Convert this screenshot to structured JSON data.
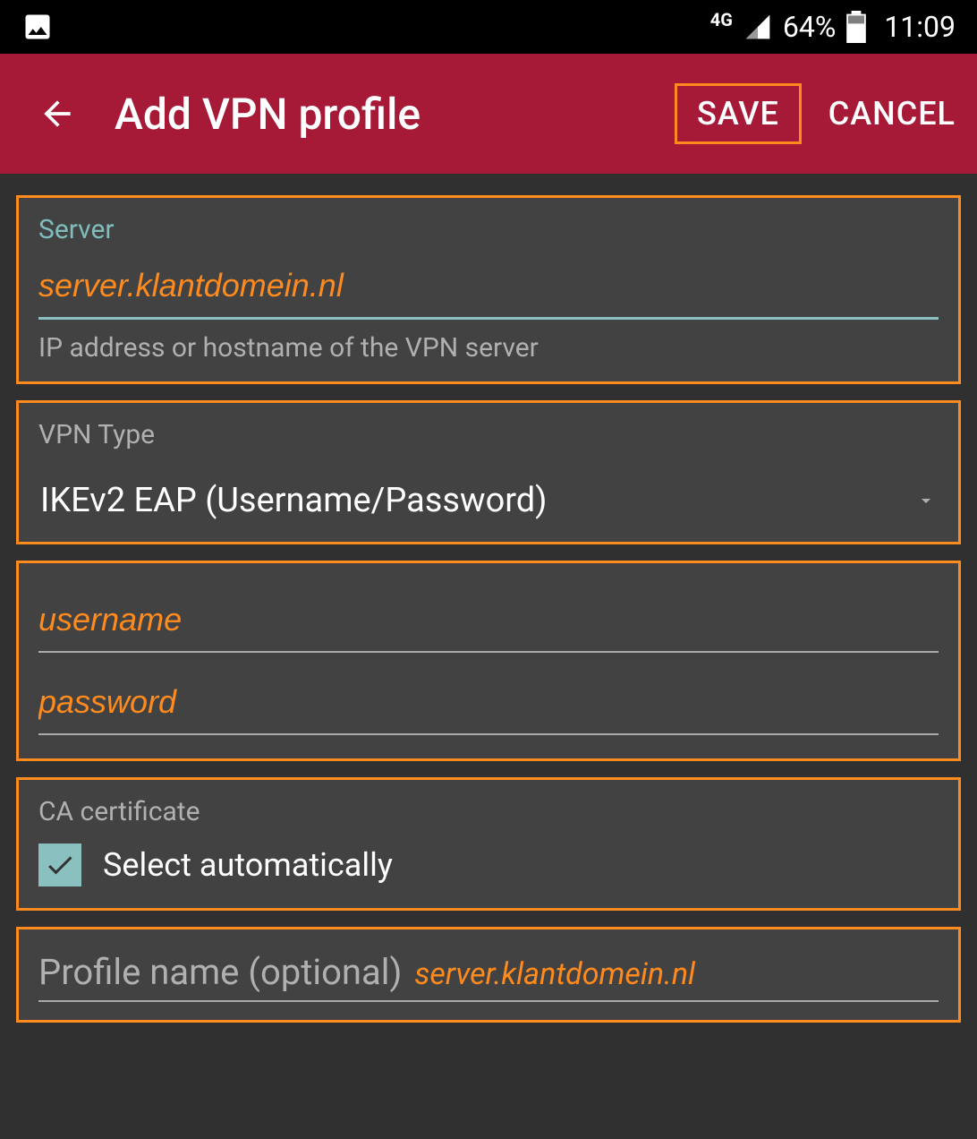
{
  "status": {
    "network_label": "4G",
    "battery_percent": "64%",
    "time": "11:09"
  },
  "header": {
    "title": "Add VPN profile",
    "save_label": "SAVE",
    "cancel_label": "CANCEL"
  },
  "server": {
    "label": "Server",
    "value": "server.klantdomein.nl",
    "helper": "IP address or hostname of the VPN server"
  },
  "vpn_type": {
    "label": "VPN Type",
    "value": "IKEv2 EAP (Username/Password)"
  },
  "credentials": {
    "username_placeholder": "username",
    "password_placeholder": "password"
  },
  "ca_cert": {
    "label": "CA certificate",
    "checkbox_label": "Select automatically",
    "checked": true
  },
  "profile_name": {
    "label": "Profile name (optional)",
    "value": "server.klantdomein.nl"
  },
  "colors": {
    "accent_orange": "#ff8a1e",
    "brand_red": "#a61937",
    "teal": "#8bc0c0",
    "surface": "#424242",
    "background": "#303030"
  }
}
